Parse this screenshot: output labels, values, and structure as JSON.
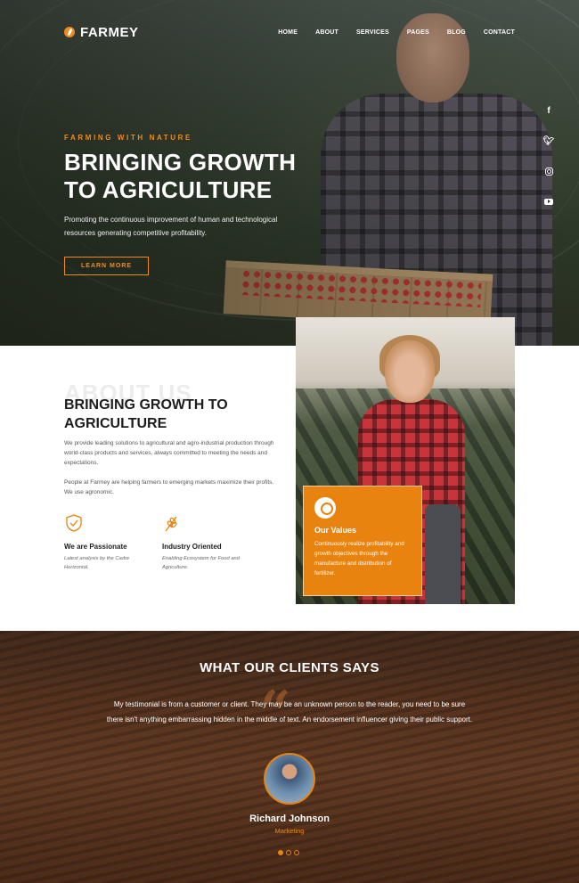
{
  "brand": {
    "name": "FARMEY",
    "accent": "#e8830f"
  },
  "nav": {
    "items": [
      "HOME",
      "ABOUT",
      "SERVICES",
      "PAGES",
      "BLOG",
      "CONTACT"
    ]
  },
  "social": [
    "facebook-icon",
    "twitter-icon",
    "instagram-icon",
    "youtube-icon"
  ],
  "hero": {
    "eyebrow": "FARMING WITH NATURE",
    "title": "BRINGING GROWTH TO AGRICULTURE",
    "description": "Promoting the continuous improvement of human and technological resources generating competitive profitability.",
    "button": "LEARN MORE"
  },
  "about": {
    "bg_word": "ABOUT US",
    "title": "BRINGING GROWTH TO AGRICULTURE",
    "p1": "We provide leading solutions to agricultural and agro-industrial production through world-class products and services, always committed to meeting the needs and expectations.",
    "p2": "People at Farmey are helping farmers to emerging markets maximize their profits. We use agronomic.",
    "features": [
      {
        "title": "We are Passionate",
        "desc": "Latest analysis by the Cadre Horizontal."
      },
      {
        "title": "Industry Oriented",
        "desc": "Enabling Ecosystem for Food and Agriculture."
      }
    ],
    "values": {
      "title": "Our Values",
      "desc": "Continuously realize profitability and growth objectives through the manufacture and distribution of fertilizer."
    }
  },
  "testimonial": {
    "title": "WHAT OUR CLIENTS SAYS",
    "text": "My testimonial is from a customer or client. They may be an unknown person to the reader, you need to be sure there isn't anything embarrassing hidden in the middle of text. An endorsement influencer giving their public support.",
    "name": "Richard Johnson",
    "role": "Marketing",
    "slides": 3,
    "active_slide": 1
  }
}
